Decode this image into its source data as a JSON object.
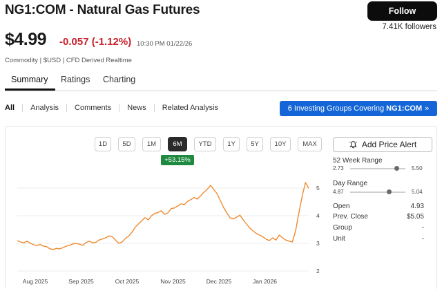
{
  "header": {
    "title": "NG1:COM - Natural Gas Futures",
    "follow_label": "Follow",
    "followers": "7.41K followers"
  },
  "quote": {
    "price": "$4.99",
    "change": "-0.057 (-1.12%)",
    "timestamp": "10:30 PM 01/22/26",
    "meta": "Commodity | $USD | CFD Derived Realtime"
  },
  "tabs": [
    {
      "label": "Summary",
      "active": true
    },
    {
      "label": "Ratings",
      "active": false
    },
    {
      "label": "Charting",
      "active": false
    }
  ],
  "filters": [
    "All",
    "Analysis",
    "Comments",
    "News",
    "Related Analysis"
  ],
  "groups_button": {
    "text": "6 Investing Groups Covering",
    "ticker": "NG1:COM",
    "chevron": "»"
  },
  "chart": {
    "ranges": [
      "1D",
      "5D",
      "1M",
      "6M",
      "YTD",
      "1Y",
      "5Y",
      "10Y",
      "MAX"
    ],
    "active_range": "6M",
    "period_change": "+53.15%",
    "line_color": "#f0892f",
    "badge_color": "#1d8a3f"
  },
  "chart_data": {
    "type": "line",
    "x_tick_labels": [
      "Aug 2025",
      "Sep 2025",
      "Oct 2025",
      "Nov 2025",
      "Dec 2025",
      "Jan 2026"
    ],
    "y_tick_labels": [
      "5",
      "4",
      "3",
      "2"
    ],
    "ylim": [
      1.9,
      5.35
    ],
    "grid": true,
    "series": [
      {
        "values": [
          3.1,
          3.05,
          3.02,
          3.08,
          3.0,
          2.95,
          2.92,
          2.96,
          2.9,
          2.88,
          2.8,
          2.78,
          2.82,
          2.8,
          2.85,
          2.9,
          2.93,
          2.98,
          3.0,
          2.97,
          2.93,
          3.03,
          3.08,
          3.02,
          3.04,
          3.12,
          3.16,
          3.2,
          3.27,
          3.24,
          3.12,
          3.0,
          3.05,
          3.18,
          3.26,
          3.4,
          3.58,
          3.7,
          3.82,
          3.93,
          3.85,
          4.0,
          4.08,
          4.12,
          4.18,
          4.05,
          4.1,
          4.26,
          4.28,
          4.35,
          4.43,
          4.4,
          4.52,
          4.58,
          4.66,
          4.6,
          4.72,
          4.85,
          4.95,
          5.1,
          4.95,
          4.8,
          4.55,
          4.3,
          4.1,
          3.92,
          3.88,
          3.95,
          4.02,
          3.85,
          3.7,
          3.55,
          3.45,
          3.36,
          3.3,
          3.24,
          3.15,
          3.1,
          3.2,
          3.12,
          3.3,
          3.2,
          3.12,
          3.08,
          3.05,
          3.45,
          4.1,
          4.7,
          5.2,
          4.99
        ]
      }
    ]
  },
  "price_alert": {
    "label": "Add Price Alert"
  },
  "stats": {
    "week52": {
      "label": "52 Week Range",
      "low": "2.73",
      "high": "5.50",
      "position": 0.84
    },
    "day": {
      "label": "Day Range",
      "low": "4.87",
      "high": "5.04",
      "position": 0.7
    },
    "rows": [
      {
        "label": "Open",
        "value": "4.93"
      },
      {
        "label": "Prev. Close",
        "value": "$5.05"
      },
      {
        "label": "Group",
        "value": "-"
      },
      {
        "label": "Unit",
        "value": "-"
      }
    ]
  }
}
